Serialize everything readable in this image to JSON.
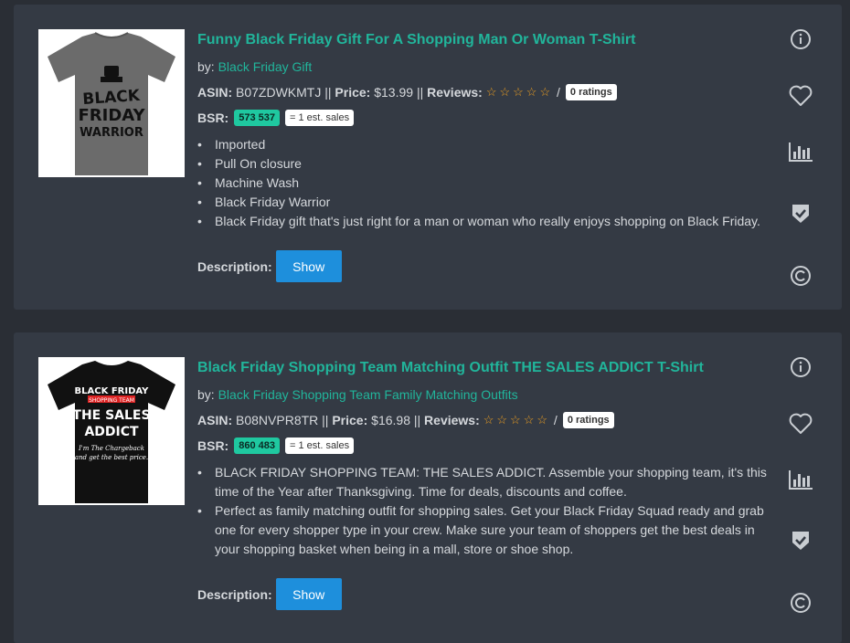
{
  "colors": {
    "accent": "#21b59b",
    "card": "#343a44",
    "button": "#1e8fdc",
    "bsr_badge": "#1fc8a0",
    "star": "#f0a020"
  },
  "products": [
    {
      "title": "Funny Black Friday Gift For A Shopping Man Or Woman T-Shirt",
      "by_label": "by:",
      "brand": "Black Friday Gift",
      "asin_label": "ASIN:",
      "asin": "B07ZDWKMTJ",
      "price_label": "Price:",
      "price": "$13.99",
      "reviews_label": "Reviews:",
      "rating_stars": 0,
      "ratings_badge": "0 ratings",
      "bsr_label": "BSR:",
      "bsr": "573 537",
      "est_sales": "= 1 est. sales",
      "bullets": [
        "Imported",
        "Pull On closure",
        "Machine Wash",
        "Black Friday Warrior",
        "Black Friday gift that's just right for a man or woman who really enjoys shopping on Black Friday."
      ],
      "description_label": "Description:",
      "show_label": "Show",
      "shirt": {
        "color": "#6b6b6b",
        "lines": [
          "BLACK",
          "FRIDAY",
          "WARRIOR"
        ]
      }
    },
    {
      "title": "Black Friday Shopping Team Matching Outfit THE SALES ADDICT T-Shirt",
      "by_label": "by:",
      "brand": "Black Friday Shopping Team Family Matching Outfits",
      "asin_label": "ASIN:",
      "asin": "B08NVPR8TR",
      "price_label": "Price:",
      "price": "$16.98",
      "reviews_label": "Reviews:",
      "rating_stars": 0,
      "ratings_badge": "0 ratings",
      "bsr_label": "BSR:",
      "bsr": "860 483",
      "est_sales": "= 1 est. sales",
      "bullets": [
        "BLACK FRIDAY SHOPPING TEAM: THE SALES ADDICT. Assemble your shopping team, it's this time of the Year after Thanksgiving. Time for deals, discounts and coffee.",
        "Perfect as family matching outfit for shopping sales. Get your Black Friday Squad ready and grab one for every shopper type in your crew. Make sure your team of shoppers get the best deals in your shopping basket when being in a mall, store or shoe shop."
      ],
      "description_label": "Description:",
      "show_label": "Show",
      "shirt": {
        "color": "#111111",
        "lines": [
          "BLACK FRIDAY",
          "SHOPPING TEAM",
          "THE SALES",
          "ADDICT",
          "I'm The Chargeback",
          "and get the best price."
        ]
      }
    }
  ],
  "icons": [
    "info-icon",
    "heart-icon",
    "bar-chart-icon",
    "shield-check-icon",
    "copyright-icon"
  ]
}
